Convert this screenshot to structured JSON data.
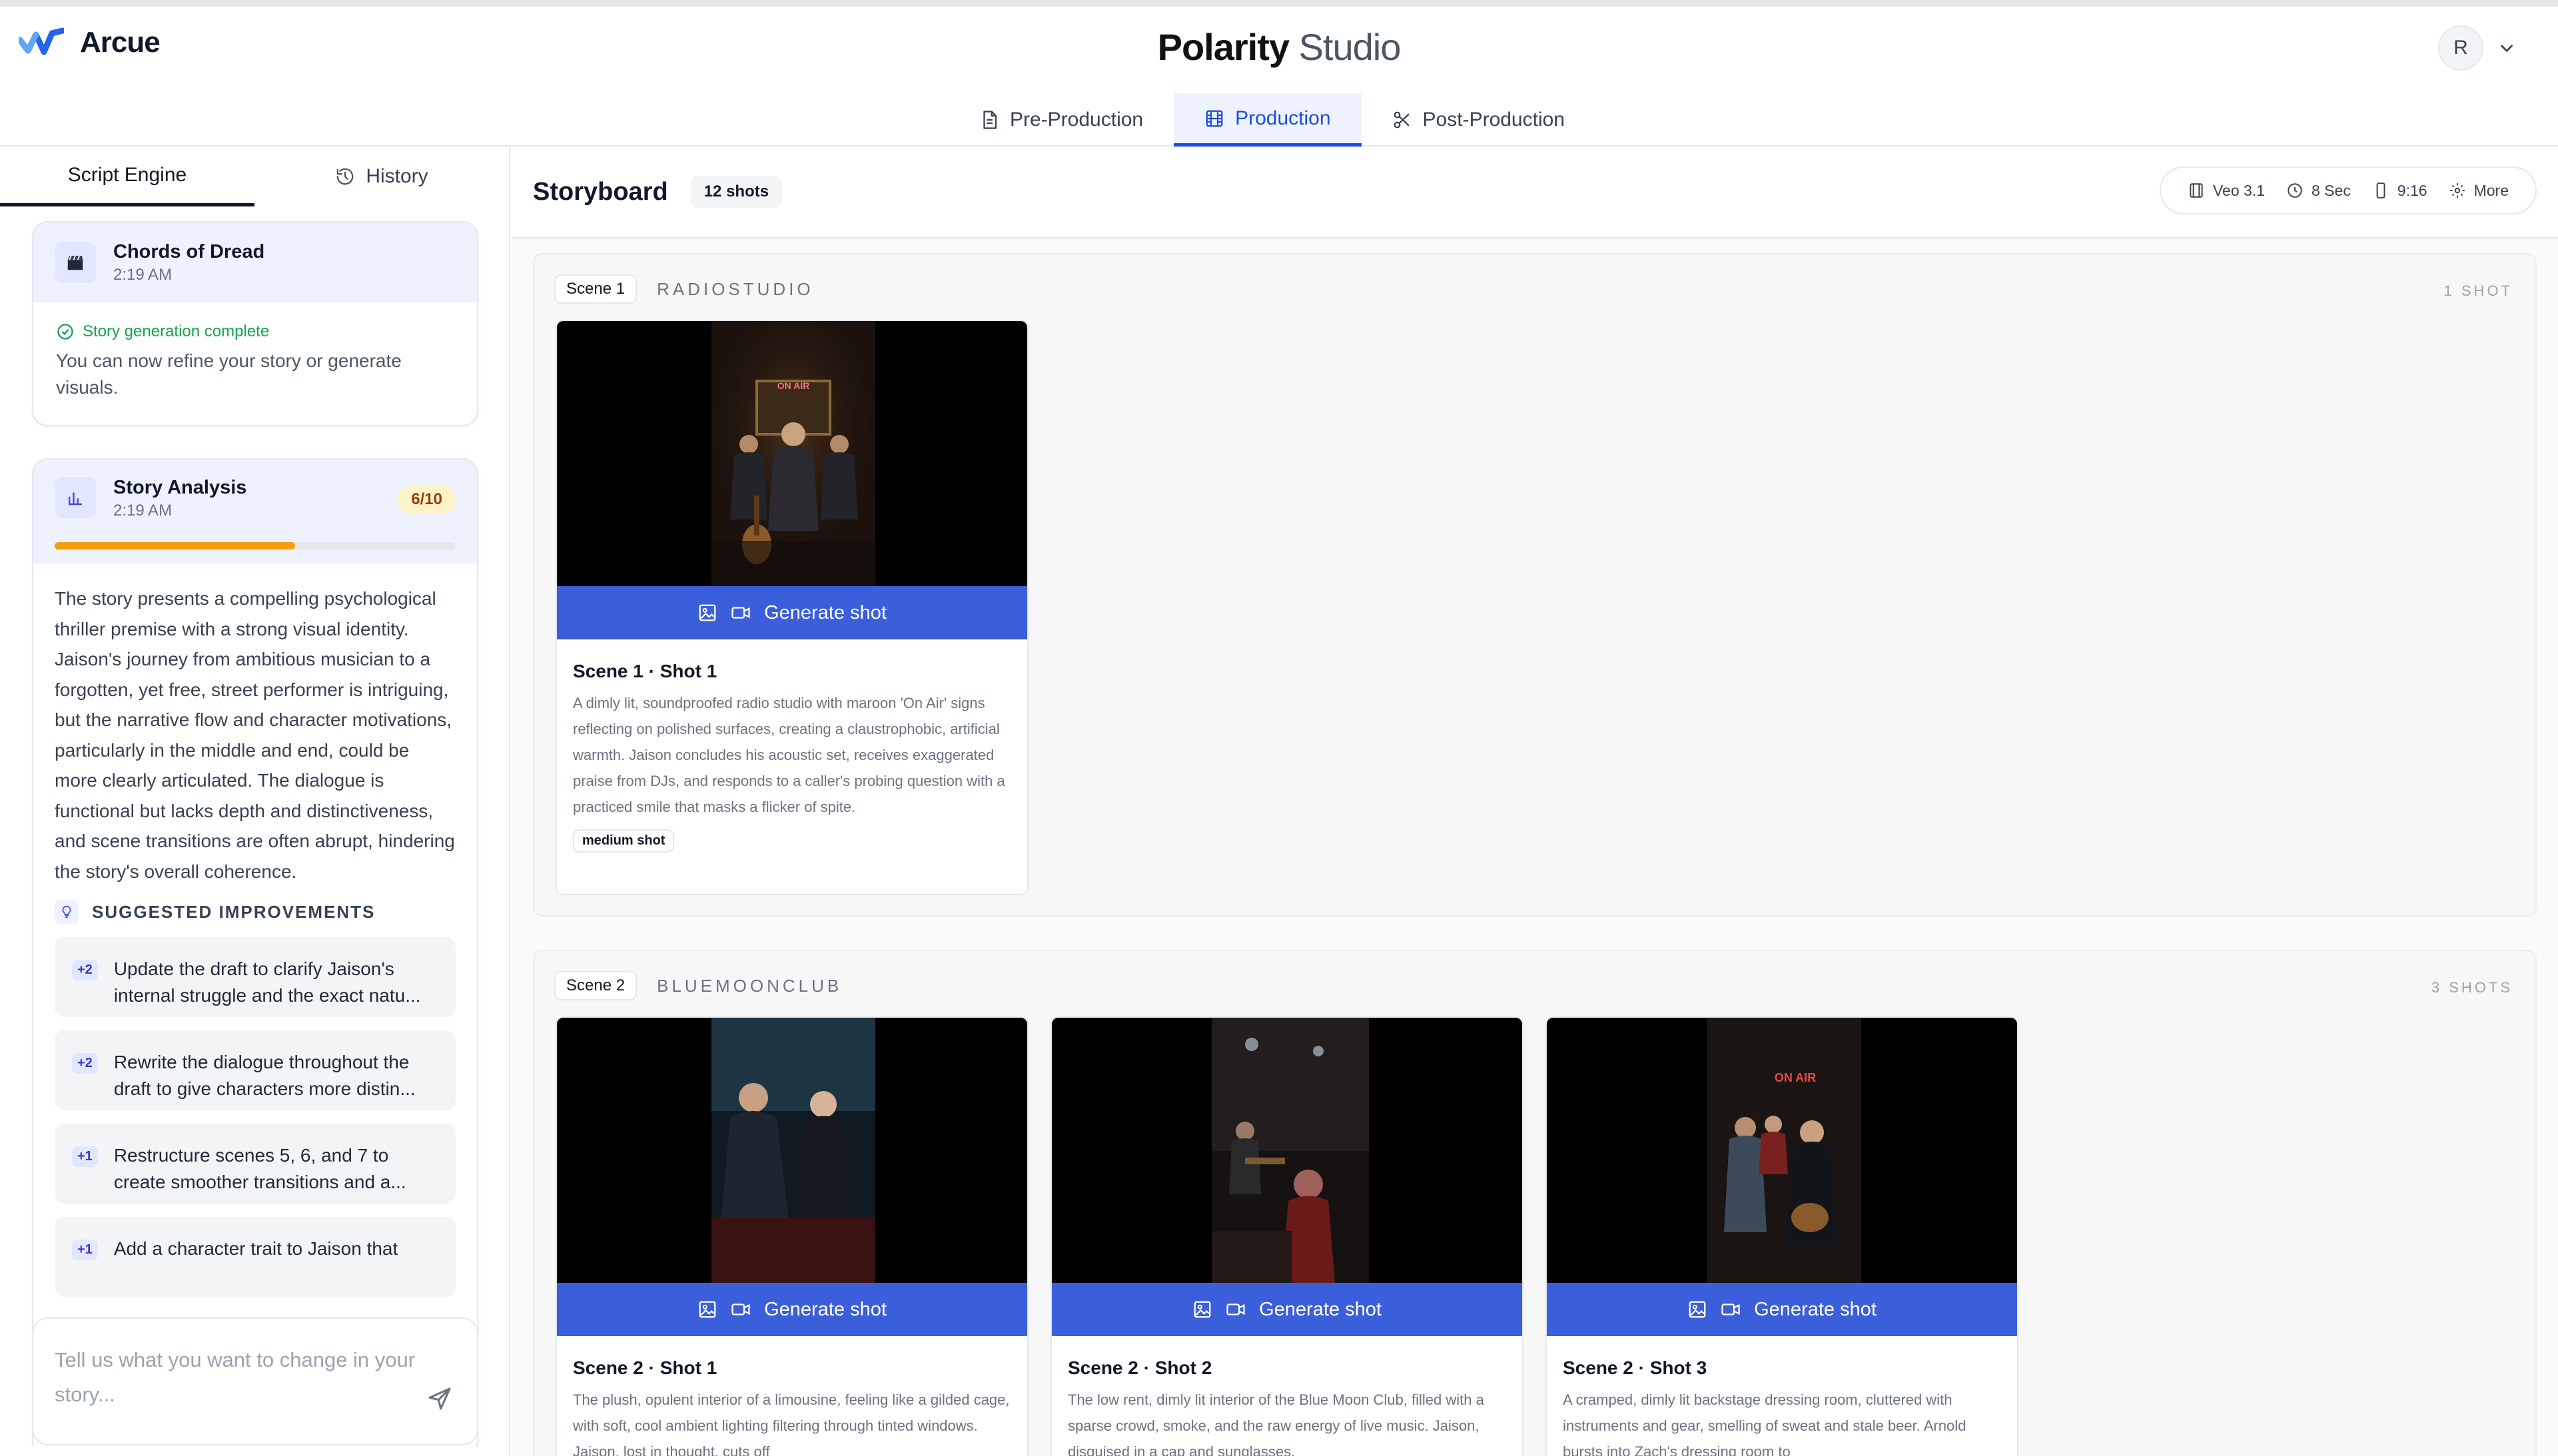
{
  "header": {
    "logo_text": "Arcue",
    "brand_bold": "Polarity",
    "brand_light": "Studio",
    "avatar_initial": "R",
    "tabs": [
      {
        "label": "Pre-Production",
        "icon": "document-icon"
      },
      {
        "label": "Production",
        "icon": "film-icon"
      },
      {
        "label": "Post-Production",
        "icon": "scissors-icon"
      }
    ],
    "active_tab": "Production"
  },
  "sidebar": {
    "tabs": [
      {
        "label": "Script Engine"
      },
      {
        "label": "History",
        "icon": "history-icon"
      }
    ],
    "story_card": {
      "title": "Chords of Dread",
      "time": "2:19 AM",
      "status": "Story generation complete",
      "message": "You can now refine your story or generate visuals."
    },
    "analysis_card": {
      "title": "Story Analysis",
      "time": "2:19 AM",
      "score": "6/10",
      "score_fraction": 0.6,
      "text": "The story presents a compelling psychological thriller premise with a strong visual identity. Jaison's journey from ambitious musician to a forgotten, yet free, street performer is intriguing, but the narrative flow and character motivations, particularly in the middle and end, could be more clearly articulated. The dialogue is functional but lacks depth and distinctiveness, and scene transitions are often abrupt, hindering the story's overall coherence.",
      "suggestions_heading": "SUGGESTED IMPROVEMENTS",
      "suggestions": [
        {
          "badge": "+2",
          "text": "Update the draft to clarify Jaison's internal struggle and the exact natu..."
        },
        {
          "badge": "+2",
          "text": "Rewrite the dialogue throughout the draft to give characters more distin..."
        },
        {
          "badge": "+1",
          "text": "Restructure scenes 5, 6, and 7 to create smoother transitions and a..."
        },
        {
          "badge": "+1",
          "text": "Add a character trait to Jaison that"
        }
      ]
    },
    "composer_placeholder": "Tell us what you want to change in your story..."
  },
  "storyboard": {
    "title": "Storyboard",
    "count": "12 shots",
    "options": [
      {
        "label": "Veo 3.1",
        "icon": "film-icon"
      },
      {
        "label": "8 Sec",
        "icon": "clock-icon"
      },
      {
        "label": "9:16",
        "icon": "phone-icon"
      },
      {
        "label": "More",
        "icon": "gear-icon"
      }
    ],
    "generate_label": "Generate shot",
    "scenes": [
      {
        "label": "Scene 1",
        "location": "RADIOSTUDIO",
        "count": "1 SHOT",
        "shots": [
          {
            "title": "Scene 1 · Shot 1",
            "description": "A dimly lit, soundproofed radio studio with maroon 'On Air' signs reflecting on polished surfaces, creating a claustrophobic, artificial warmth. Jaison concludes his acoustic set, receives exaggerated praise from DJs, and responds to a caller's probing question with a practiced smile that masks a flicker of spite.",
            "tag": "medium shot",
            "sign": "ON AIR"
          }
        ]
      },
      {
        "label": "Scene 2",
        "location": "BLUEMOONCLUB",
        "count": "3 SHOTS",
        "shots": [
          {
            "title": "Scene 2 · Shot 1",
            "description": "The plush, opulent interior of a limousine, feeling like a gilded cage, with soft, cool ambient lighting filtering through tinted windows. Jaison, lost in thought, cuts off"
          },
          {
            "title": "Scene 2 · Shot 2",
            "description": "The low rent, dimly lit interior of the Blue Moon Club, filled with a sparse crowd, smoke, and the raw energy of live music. Jaison, disguised in a cap and sunglasses,"
          },
          {
            "title": "Scene 2 · Shot 3",
            "description": "A cramped, dimly lit backstage dressing room, cluttered with instruments and gear, smelling of sweat and stale beer. Arnold bursts into Zach's dressing room to",
            "sign": "ON AIR"
          }
        ]
      }
    ]
  },
  "colors": {
    "accent": "#1d4ed8",
    "generate_button": "#3b5fdb",
    "success": "#16a34a",
    "score_bar": "#f59e0b",
    "score_badge_bg": "#fef3c7"
  }
}
